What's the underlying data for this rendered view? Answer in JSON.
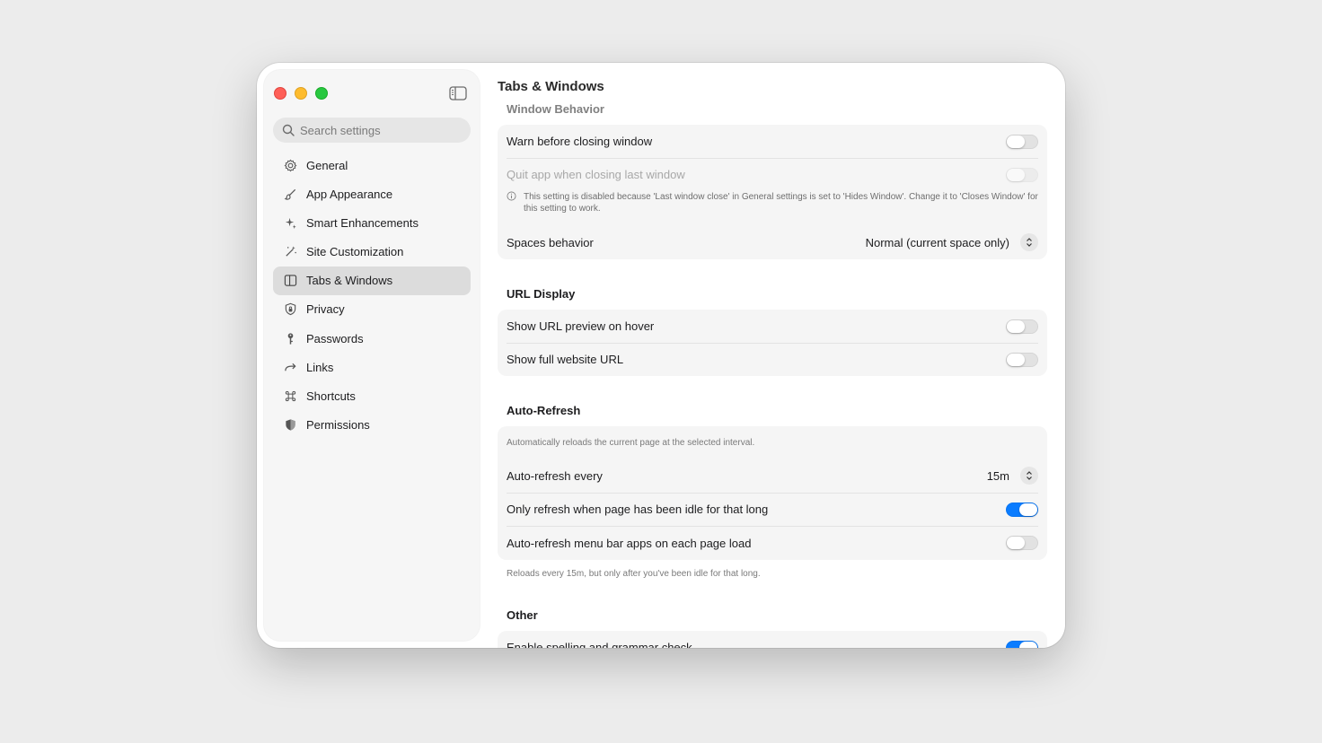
{
  "sidebar": {
    "search_placeholder": "Search settings",
    "items": [
      {
        "label": "General",
        "icon": "gear-icon"
      },
      {
        "label": "App Appearance",
        "icon": "paintbrush-icon"
      },
      {
        "label": "Smart Enhancements",
        "icon": "sparkles-icon"
      },
      {
        "label": "Site Customization",
        "icon": "magic-wand-icon"
      },
      {
        "label": "Tabs & Windows",
        "icon": "sidebar-panel-icon",
        "active": true
      },
      {
        "label": "Privacy",
        "icon": "shield-lock-icon"
      },
      {
        "label": "Passwords",
        "icon": "key-icon"
      },
      {
        "label": "Links",
        "icon": "arrow-forward-icon"
      },
      {
        "label": "Shortcuts",
        "icon": "command-icon"
      },
      {
        "label": "Permissions",
        "icon": "shield-check-icon"
      }
    ]
  },
  "page_title": "Tabs & Windows",
  "sections": {
    "window_behavior": {
      "title": "Window Behavior",
      "warn_label": "Warn before closing window",
      "warn_on": false,
      "quit_label": "Quit app when closing last window",
      "quit_on": false,
      "quit_info": "This setting is disabled because 'Last window close' in General settings is set to 'Hides Window'. Change it to 'Closes Window' for this setting to work.",
      "spaces_label": "Spaces behavior",
      "spaces_value": "Normal (current space only)"
    },
    "url_display": {
      "title": "URL Display",
      "preview_label": "Show URL preview on hover",
      "preview_on": false,
      "full_url_label": "Show full website URL",
      "full_url_on": false
    },
    "auto_refresh": {
      "title": "Auto-Refresh",
      "description": "Automatically reloads the current page at the selected interval.",
      "every_label": "Auto-refresh every",
      "every_value": "15m",
      "idle_label": "Only refresh when page has been idle for that long",
      "idle_on": true,
      "menubar_label": "Auto-refresh menu bar apps on each page load",
      "menubar_on": false,
      "caption": "Reloads every 15m, but only after you've been idle for that long."
    },
    "other": {
      "title": "Other",
      "spelling_label": "Enable spelling and grammar check",
      "spelling_on": true
    }
  },
  "colors": {
    "accent": "#0a7cff",
    "close": "#fe5f57",
    "minimize": "#febc2e",
    "maximize": "#28c840"
  }
}
